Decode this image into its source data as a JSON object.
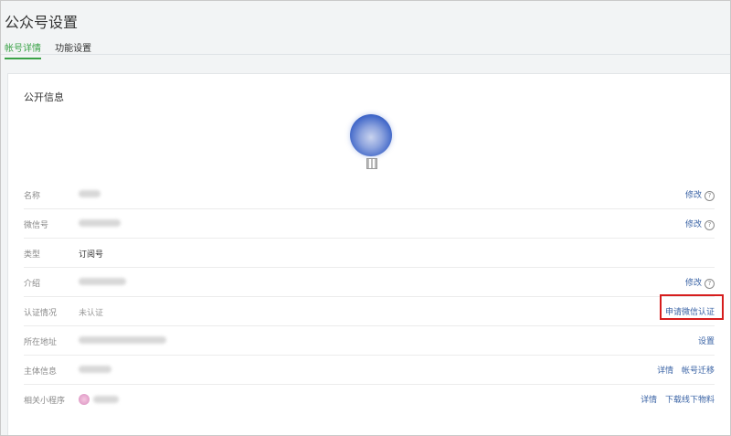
{
  "header": {
    "title": "公众号设置",
    "tabs": [
      {
        "label": "帐号详情",
        "active": true
      },
      {
        "label": "功能设置",
        "active": false
      }
    ]
  },
  "section": {
    "title": "公开信息"
  },
  "rows": [
    {
      "label": "名称",
      "value": "",
      "actions": [
        "修改"
      ],
      "help": true
    },
    {
      "label": "微信号",
      "value": "",
      "actions": [
        "修改"
      ],
      "help": true
    },
    {
      "label": "类型",
      "value": "订阅号",
      "actions": [],
      "help": false
    },
    {
      "label": "介绍",
      "value": "",
      "actions": [
        "修改"
      ],
      "help": true
    },
    {
      "label": "认证情况",
      "value": "未认证",
      "actions": [
        "申请微信认证"
      ],
      "help": false
    },
    {
      "label": "所在地址",
      "value": "",
      "actions": [
        "设置"
      ],
      "help": false
    },
    {
      "label": "主体信息",
      "value": "",
      "actions": [
        "详情",
        "帐号迁移"
      ],
      "help": false
    },
    {
      "label": "相关小程序",
      "value": "",
      "actions": [
        "详情",
        "下载线下物料"
      ],
      "help": false
    }
  ],
  "colors": {
    "accent_green": "#3aa247",
    "link_blue": "#3a63a5",
    "highlight_red": "#d61d1d"
  },
  "icons": {
    "help": "question-circle-icon",
    "qr": "qr-code-icon",
    "avatar": "account-avatar"
  }
}
